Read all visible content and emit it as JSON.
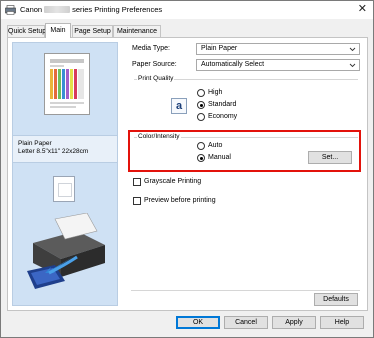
{
  "window": {
    "title_prefix": "Canon",
    "title_suffix": "series Printing Preferences",
    "close_glyph": "✕"
  },
  "tabs": [
    {
      "label": "Quick Setup",
      "active": false
    },
    {
      "label": "Main",
      "active": true
    },
    {
      "label": "Page Setup",
      "active": false
    },
    {
      "label": "Maintenance",
      "active": false
    }
  ],
  "preview": {
    "paper_type": "Plain Paper",
    "paper_size": "Letter 8.5\"x11\" 22x28cm"
  },
  "media_type": {
    "label": "Media Type:",
    "value": "Plain Paper"
  },
  "paper_source": {
    "label": "Paper Source:",
    "value": "Automatically Select"
  },
  "print_quality": {
    "title": "Print Quality",
    "icon_letter": "a",
    "options": [
      "High",
      "Standard",
      "Economy"
    ],
    "selected": "Standard"
  },
  "color_intensity": {
    "title": "Color/Intensity",
    "options": [
      "Auto",
      "Manual"
    ],
    "selected": "Manual",
    "set_button": "Set..."
  },
  "grayscale": {
    "label": "Grayscale Printing",
    "checked": false
  },
  "preview_before": {
    "label": "Preview before printing",
    "checked": false
  },
  "defaults_button": "Defaults",
  "footer": {
    "ok": "OK",
    "cancel": "Cancel",
    "apply": "Apply",
    "help": "Help"
  },
  "colors": {
    "highlight": "#e3120b",
    "preview_bg": "#cfe1f4",
    "default_button_border": "#0078d7"
  }
}
